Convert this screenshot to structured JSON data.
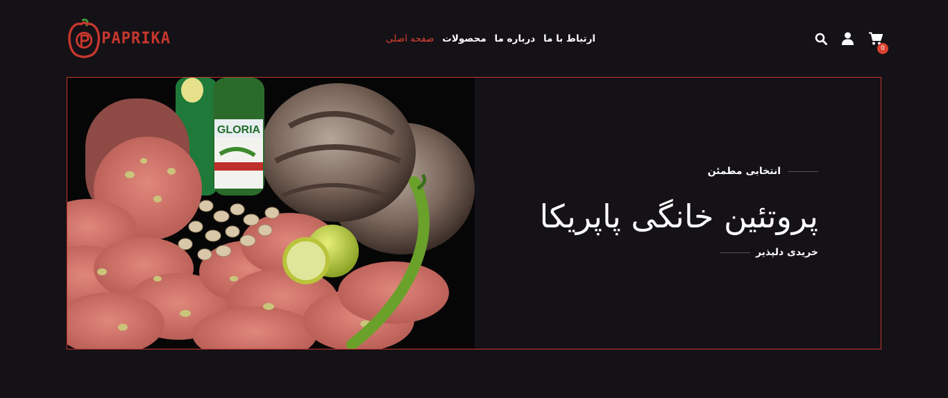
{
  "brand": {
    "name": "PAPRIKA",
    "color": "#c8372d"
  },
  "nav": {
    "items": [
      {
        "label": "صفحه اصلی",
        "active": true
      },
      {
        "label": "محصولات",
        "active": false
      },
      {
        "label": "درباره ما",
        "active": false
      },
      {
        "label": "ارتباط با ما",
        "active": false
      }
    ]
  },
  "header_icons": {
    "search": "search-icon",
    "user": "user-icon",
    "cart": "cart-icon",
    "cart_count": "0"
  },
  "hero": {
    "eyebrow": "انتخابی مطمئن",
    "title": "پروتئین خانگی پاپریکا",
    "cta": "خریدی دلپذیر",
    "image": "meat-products-photo"
  },
  "colors": {
    "background": "#141217",
    "accent": "#d9422f"
  }
}
